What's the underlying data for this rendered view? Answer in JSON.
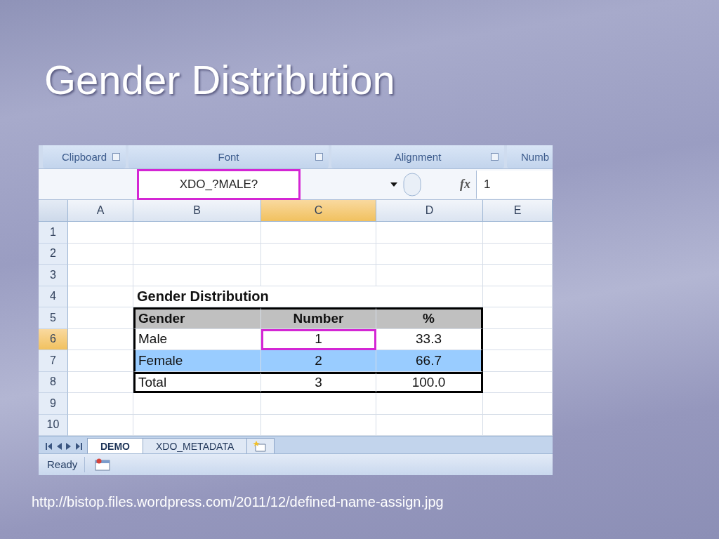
{
  "slide": {
    "title": "Gender Distribution",
    "caption": "http://bistop.files.wordpress.com/2011/12/defined-name-assign.jpg"
  },
  "ribbon_groups": [
    "Clipboard",
    "Font",
    "Alignment",
    "Numb"
  ],
  "formula_bar": {
    "name_box": "XDO_?MALE?",
    "function_label": "fx",
    "formula": "1"
  },
  "columns": [
    {
      "label": "A",
      "selected": false
    },
    {
      "label": "B",
      "selected": false
    },
    {
      "label": "C",
      "selected": true
    },
    {
      "label": "D",
      "selected": false
    },
    {
      "label": "E",
      "selected": false
    }
  ],
  "rows": [
    {
      "label": "1",
      "selected": false,
      "kind": "blank"
    },
    {
      "label": "2",
      "selected": false,
      "kind": "blank"
    },
    {
      "label": "3",
      "selected": false,
      "kind": "blank"
    },
    {
      "label": "4",
      "selected": false,
      "kind": "caption",
      "cells": [
        {
          "text": "Gender Distribution"
        }
      ]
    },
    {
      "label": "5",
      "selected": false,
      "kind": "header",
      "cells": [
        {
          "text": "Gender",
          "selected": false
        },
        {
          "text": "Number",
          "selected": false
        },
        {
          "text": "%",
          "selected": false
        }
      ]
    },
    {
      "label": "6",
      "selected": true,
      "kind": "data",
      "highlighted": false,
      "cells": [
        {
          "text": "Male",
          "selected": false
        },
        {
          "text": "1",
          "selected": true
        },
        {
          "text": "33.3",
          "selected": false
        }
      ]
    },
    {
      "label": "7",
      "selected": false,
      "kind": "data",
      "highlighted": true,
      "cells": [
        {
          "text": "Female",
          "selected": false
        },
        {
          "text": "2",
          "selected": false
        },
        {
          "text": "66.7",
          "selected": false
        }
      ]
    },
    {
      "label": "8",
      "selected": false,
      "kind": "total",
      "cells": [
        {
          "text": "Total",
          "selected": false
        },
        {
          "text": "3",
          "selected": false
        },
        {
          "text": "100.0",
          "selected": false
        }
      ]
    },
    {
      "label": "9",
      "selected": false,
      "kind": "blank"
    },
    {
      "label": "10",
      "selected": false,
      "kind": "blank"
    }
  ],
  "sheet_tabs": [
    {
      "label": "DEMO",
      "selected": true
    },
    {
      "label": "XDO_METADATA",
      "selected": false
    }
  ],
  "status_bar": {
    "text": "Ready"
  }
}
